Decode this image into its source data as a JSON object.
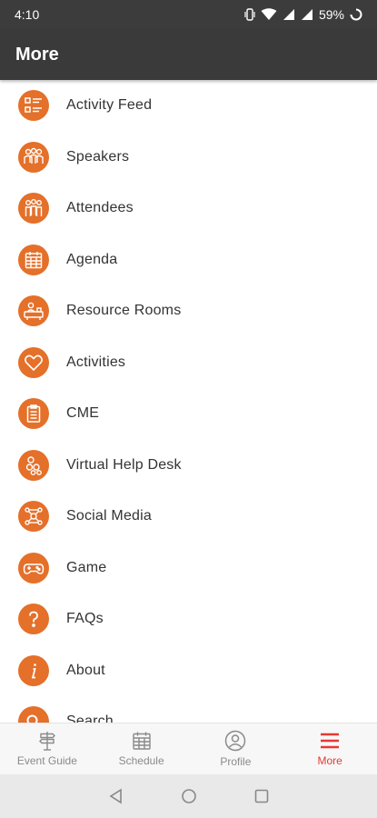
{
  "status_bar": {
    "time": "4:10",
    "battery": "59%",
    "icons": [
      "vibrate-icon",
      "wifi-icon",
      "signal-icon",
      "signal-icon",
      "battery-saver-icon"
    ]
  },
  "header": {
    "title": "More"
  },
  "colors": {
    "accent": "#e4702a",
    "active_tab": "#e53935",
    "app_bar": "#3a3a3a"
  },
  "menu": {
    "items": [
      {
        "label": "Activity Feed",
        "icon": "activity-feed-icon"
      },
      {
        "label": "Speakers",
        "icon": "speakers-icon"
      },
      {
        "label": "Attendees",
        "icon": "attendees-icon"
      },
      {
        "label": "Agenda",
        "icon": "agenda-icon"
      },
      {
        "label": "Resource Rooms",
        "icon": "resource-rooms-icon"
      },
      {
        "label": "Activities",
        "icon": "heart-icon"
      },
      {
        "label": "CME",
        "icon": "clipboard-icon"
      },
      {
        "label": "Virtual Help Desk",
        "icon": "help-desk-icon"
      },
      {
        "label": "Social Media",
        "icon": "social-media-icon"
      },
      {
        "label": "Game",
        "icon": "gamepad-icon"
      },
      {
        "label": "FAQs",
        "icon": "question-icon"
      },
      {
        "label": "About",
        "icon": "info-icon"
      },
      {
        "label": "Search",
        "icon": "search-icon"
      }
    ]
  },
  "bottom_nav": {
    "tabs": [
      {
        "label": "Event Guide",
        "icon": "signpost-icon"
      },
      {
        "label": "Schedule",
        "icon": "calendar-icon"
      },
      {
        "label": "Profile",
        "icon": "profile-icon"
      },
      {
        "label": "More",
        "icon": "menu-icon",
        "active": true
      }
    ]
  }
}
